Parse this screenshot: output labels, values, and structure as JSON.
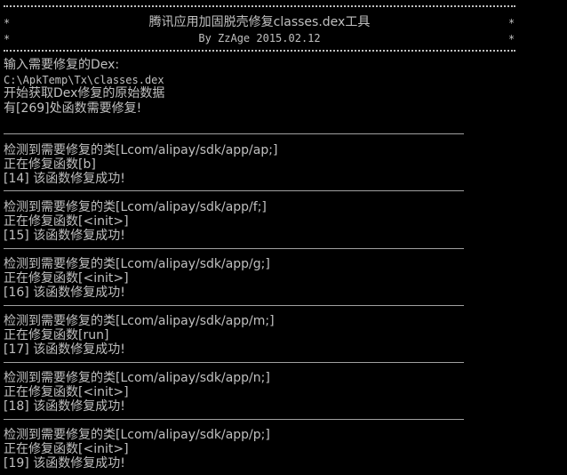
{
  "header": {
    "title": "腾讯应用加固脱壳修复classes.dex工具",
    "byline": "By ZzAge 2015.02.12",
    "star_char": "*"
  },
  "intro": {
    "prompt": "输入需要修复的Dex:",
    "path": "C:\\ApkTemp\\Tx\\classes.dex",
    "fetching": "开始获取Dex修复的原始数据",
    "count_msg": "有[269]处函数需要修复!"
  },
  "blocks": [
    {
      "detect": "检测到需要修复的类[Lcom/alipay/sdk/app/ap;]",
      "repairing": "正在修复函数[b]",
      "result": "[14] 该函数修复成功!"
    },
    {
      "detect": "检测到需要修复的类[Lcom/alipay/sdk/app/f;]",
      "repairing": "正在修复函数[<init>]",
      "result": "[15] 该函数修复成功!"
    },
    {
      "detect": "检测到需要修复的类[Lcom/alipay/sdk/app/g;]",
      "repairing": "正在修复函数[<init>]",
      "result": "[16] 该函数修复成功!"
    },
    {
      "detect": "检测到需要修复的类[Lcom/alipay/sdk/app/m;]",
      "repairing": "正在修复函数[run]",
      "result": "[17] 该函数修复成功!"
    },
    {
      "detect": "检测到需要修复的类[Lcom/alipay/sdk/app/n;]",
      "repairing": "正在修复函数[<init>]",
      "result": "[18] 该函数修复成功!"
    },
    {
      "detect": "检测到需要修复的类[Lcom/alipay/sdk/app/p;]",
      "repairing": "正在修复函数[<init>]",
      "result": "[19] 该函数修复成功!"
    }
  ]
}
